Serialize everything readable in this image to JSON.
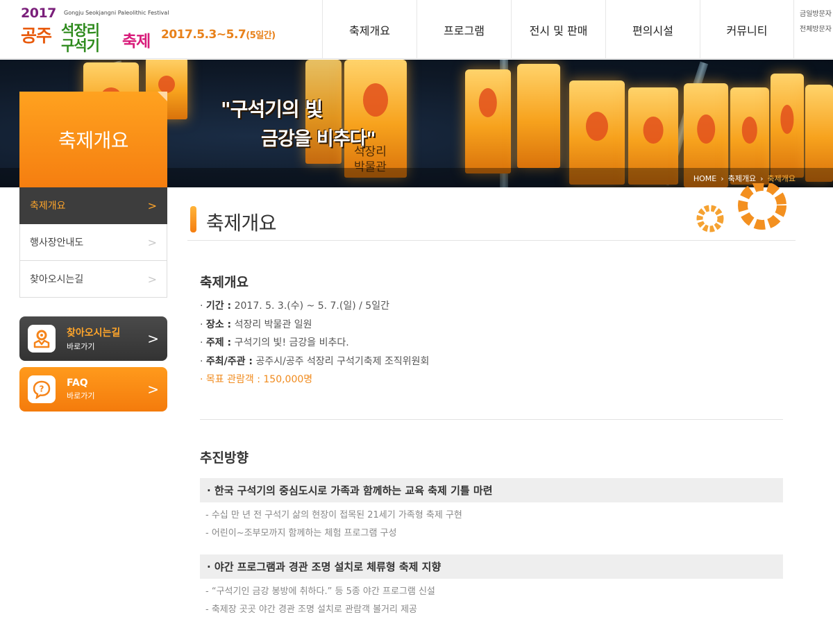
{
  "header": {
    "logo": {
      "year": "2017",
      "english_name": "Gongju Seokjangni Paleolithic Festival",
      "name_line_gongju": "공주",
      "name_line1": "석장리",
      "name_line2": "구석기",
      "name_festival": "축제"
    },
    "dates": "2017.5.3~5.7",
    "dates_suffix": "(5일간)",
    "nav": [
      "축제개요",
      "프로그램",
      "전시 및 판매",
      "편의시설",
      "커뮤니티"
    ],
    "util": [
      "금일방문자",
      "전체방문자"
    ]
  },
  "banner": {
    "slogan_line1": "\"구석기의 빛",
    "slogan_line2": "금강을 비추다\"",
    "museum_line1": "석장리",
    "museum_line2": "박물관",
    "breadcrumb": [
      "HOME",
      "축제개요",
      "축제개요"
    ]
  },
  "sidebar": {
    "title": "축제개요",
    "items": [
      {
        "label": "축제개요",
        "active": true
      },
      {
        "label": "행사장안내도",
        "active": false
      },
      {
        "label": "찾아오시는길",
        "active": false
      }
    ],
    "quick_links": [
      {
        "title": "찾아오시는길",
        "sub": "바로가기",
        "icon": "map-pin-icon"
      },
      {
        "title": "FAQ",
        "sub": "바로가기",
        "icon": "question-bubble-icon"
      }
    ]
  },
  "content": {
    "page_title": "축제개요",
    "overview_title": "축제개요",
    "overview_items": [
      {
        "label": "기간 :",
        "value": " 2017. 5. 3.(수) ~ 5. 7.(일) / 5일간"
      },
      {
        "label": "장소 :",
        "value": " 석장리 박물관 일원"
      },
      {
        "label": "주제 :",
        "value": " 구석기의 빛! 금강을 비추다."
      },
      {
        "label": "주최/주관 :",
        "value": " 공주시/공주 석장리 구석기축제 조직위원회"
      }
    ],
    "goal_text": "목표 관람객 : 150,000명",
    "direction_title": "추진방향",
    "directions": [
      {
        "heading": "한국 구석기의 중심도시로 가족과 함께하는 교육 축제 기틀 마련",
        "items": [
          "수십 만 년 전 구석기 삶의 현장이 접목된 21세기 가족형 축제 구현",
          "어린이~조부모까지 함께하는 체험 프로그램 구성"
        ]
      },
      {
        "heading": "야간 프로그램과 경관 조명 설치로 체류형 축제 지향",
        "items": [
          "“구석기인 금강 봉방에 취하다.” 등 5종 야간 프로그램 신설",
          "축제장 곳곳 야간 경관 조명 설치로 관람객 볼거리 제공"
        ]
      }
    ]
  },
  "colors": {
    "accent": "#f57e10",
    "dark": "#3d3d3d",
    "goal": "#f08a1c"
  }
}
